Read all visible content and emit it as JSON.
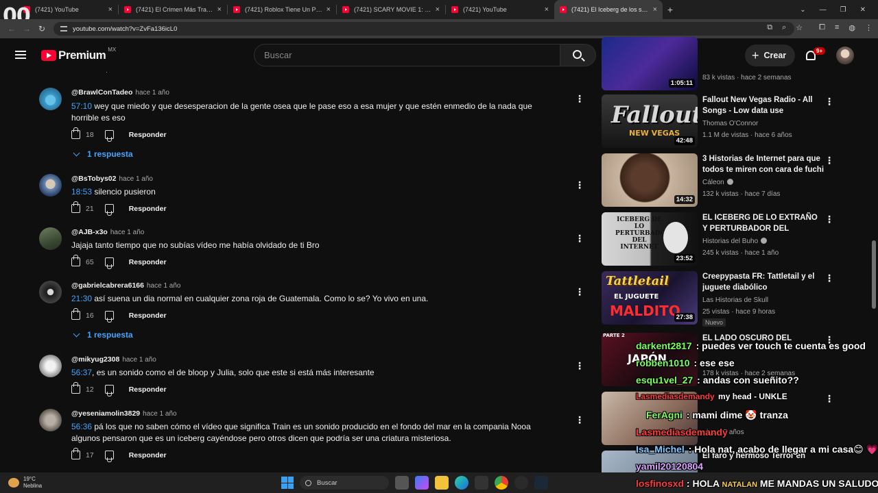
{
  "overlay_counter": "00",
  "browser": {
    "tabs": [
      {
        "label": "(7421) YouTube",
        "active": false
      },
      {
        "label": "(7421) El Crimen Más Traumátic",
        "active": false
      },
      {
        "label": "(7421) Roblox Tiene Un Problem",
        "active": false
      },
      {
        "label": "(7421) SCARY MOVIE 1: La Paro",
        "active": false
      },
      {
        "label": "(7421) YouTube",
        "active": false
      },
      {
        "label": "(7421) El Iceberg de los sonido",
        "active": true
      }
    ],
    "url": "youtube.com/watch?v=ZvFa136icL0"
  },
  "youtube": {
    "logo_text": "Premium",
    "region": "MX",
    "search_placeholder": "Buscar",
    "create_label": "Crear",
    "notif_badge": "9+"
  },
  "comments": [
    {
      "author": "@BrawlConTadeo",
      "time": "hace 1 año",
      "ts": "57:10",
      "text": " wey que miedo y que desesperacion de la gente osea que le pase eso a esa mujer y que estén enmedio de la nada que horrible es eso",
      "likes": "18",
      "reply_label": "Responder",
      "replies": "1 respuesta"
    },
    {
      "author": "@BsTobys02",
      "time": "hace 1 año",
      "ts": "18:53",
      "text": " silencio pusieron",
      "likes": "21",
      "reply_label": "Responder"
    },
    {
      "author": "@AJB-x3o",
      "time": "hace 1 año",
      "ts": "",
      "text": "Jajaja tanto tiempo que no subías vídeo me había olvidado de ti Bro",
      "likes": "65",
      "reply_label": "Responder"
    },
    {
      "author": "@gabrielcabrera6166",
      "time": "hace 1 año",
      "ts": "21:30",
      "text": " así suena un dia normal en cualquier zona roja de Guatemala. Como lo se? Yo vivo en una.",
      "likes": "16",
      "reply_label": "Responder",
      "replies": "1 respuesta"
    },
    {
      "author": "@mikyug2308",
      "time": "hace 1 año",
      "ts": "56:37",
      "text": ", es un sonido como el de bloop y Julia, solo que este si está más interesante",
      "likes": "12",
      "reply_label": "Responder"
    },
    {
      "author": "@yeseniamolin3829",
      "time": "hace 1 año",
      "ts": "56:36",
      "text": " pá los que no saben cómo el vídeo que significa Train es un sonido producido en el fondo del mar en la compania Nooa algunos pensaron que es un iceberg cayéndose pero otros dicen que podría ser una criatura misteriosa.",
      "likes": "17",
      "reply_label": "Responder"
    }
  ],
  "sidebar": [
    {
      "title": "",
      "channel": "",
      "meta": "83 k vistas · hace 2 semanas",
      "duration": "1:05:11"
    },
    {
      "title": "Fallout New Vegas Radio - All Songs - Low data use",
      "channel": "Thomas O'Connor",
      "meta": "1.1 M de vistas · hace 6 años",
      "duration": "42:48",
      "thumb_title": "Fallout",
      "thumb_sub": "NEW VEGAS"
    },
    {
      "title": "3 Historias de Internet para que todos te miren con cara de fuchi",
      "channel": "Cáleon",
      "meta": "132 k vistas · hace 7 días",
      "duration": "14:32"
    },
    {
      "title": "EL ICEBERG DE LO EXTRAÑO Y PERTURBADOR DEL INTERNE...",
      "channel": "Historias del Buho",
      "meta": "245 k vistas · hace 1 año",
      "duration": "23:52",
      "thumb_title": "ICEBERG DE LO PERTURBADOR DEL INTERNET"
    },
    {
      "title": "Creepypasta FR: Tattletail y el juguete diabólico",
      "channel": "Las Historias de Skull",
      "meta": "25 vistas · hace 9 horas",
      "duration": "27:38",
      "badge": "Nuevo",
      "thumb_title": "Tattletail",
      "thumb_sub": "EL JUGUETE",
      "thumb_sub2": "MALDITO"
    },
    {
      "title": "EL LADO OSCURO DEL",
      "channel": "",
      "meta": "178 k vistas · hace 2 semanas",
      "duration": "",
      "thumb_title": "PARTE 2",
      "thumb_sub": "JAPÓN"
    },
    {
      "title": "",
      "channel": "",
      "meta": "· hace 7 años",
      "duration": ""
    },
    {
      "title": "El faro y hermoso Terror en",
      "channel": "",
      "meta": "",
      "duration": ""
    }
  ],
  "chat": [
    {
      "user": "darkent2817",
      "msg": " : puedes ver touch te cuenta es good"
    },
    {
      "user": "robben1010",
      "msg": " : ese ese"
    },
    {
      "user": "esqu1vel_27",
      "msg": " : andas con sueñito??"
    },
    {
      "user": "Lasmediasdemandy",
      "msg": " my head - UNKLE"
    },
    {
      "user": "FerAgni",
      "msg": " : mami dime 🤡 tranza"
    },
    {
      "user": "Lasmediasdemandy",
      "msg": ""
    },
    {
      "user": "Isa_Michel",
      "msg": " : Hola nat, acabo de llegar a mi casa😊 💗"
    },
    {
      "user": "yamil20120804",
      "msg": ""
    },
    {
      "user": "losfinosxd",
      "msg": " : HOLA "
    },
    {
      "user": "NATALAN",
      "msg": " ME MANDAS UN SALUDO"
    }
  ],
  "taskbar": {
    "temp": "19°C",
    "weather": "Neblina",
    "search": "Buscar"
  },
  "colors": {
    "accent": "#3ea6ff",
    "brand": "#ff0033",
    "chat_user_green": "#7cff5c",
    "chat_user_red": "#ff3b3b",
    "chat_user_blue": "#7fc8ff",
    "chat_user_purple": "#d8a6ff"
  }
}
